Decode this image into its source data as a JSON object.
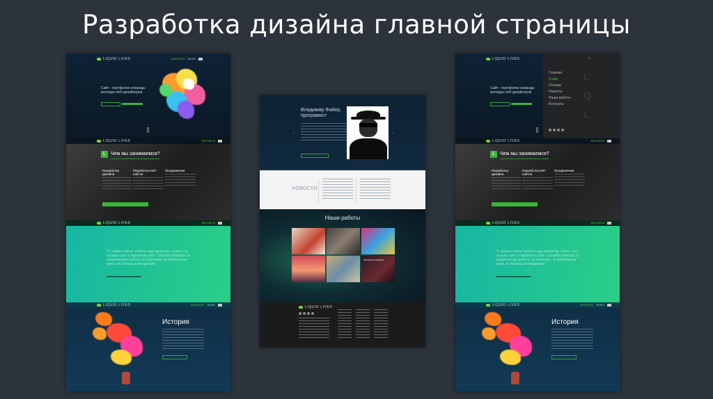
{
  "slide": {
    "title": "Разработка дизайна главной страницы"
  },
  "colors": {
    "background": "#2c333b",
    "brand_green": "#38b63b",
    "hero_dark": "#0f1f30",
    "teal_gradient_start": "#1bb4a4",
    "teal_gradient_end": "#2ad07c"
  },
  "brand": {
    "logo_text": "LIQUID LIVES"
  },
  "nav": {
    "contacts": "КОНТАКТЫ",
    "menu": "МЕНЮ"
  },
  "left_mock": {
    "hero_text": "Сайт - портфолио команды молодых веб-дизайнеров",
    "section_title": "Чем мы занимаемся?",
    "section_icon_letter": "L",
    "columns": [
      {
        "title": "Разработка дизайна"
      },
      {
        "title": "Разработка веб-сайтов"
      },
      {
        "title": "Продвижение"
      }
    ],
    "quote": "\"С первых минут работы над проектом, понял, что создаю сайт в надежные руки. Спасибо команде за проделанную работу, за терпение, за креативные идеи, за помощь в внедрении\"",
    "history_title": "История"
  },
  "center_mock": {
    "person_name": "Владимир Файер,",
    "person_role": "програмист",
    "news_label": "НОВОСТИ",
    "works_title": "Наши работы",
    "gallery_caption": "Интернет-магазин"
  },
  "right_mock": {
    "hero_text": "Сайт - портфолио команды молодых веб-дизайнеров",
    "menu_items": [
      "Главная",
      "О нас",
      "Отзывы",
      "Новости",
      "Наши работы",
      "Контакты"
    ],
    "menu_letters": [
      "L",
      "Q",
      "L"
    ],
    "section_title": "Чем мы занимаемся?",
    "section_icon_letter": "L",
    "columns": [
      {
        "title": "Разработка дизайна"
      },
      {
        "title": "Разработка веб-сайтов"
      },
      {
        "title": "Продвижение"
      }
    ],
    "quote": "\"С первых минут работы над проектом, понял, что создаю сайт в надежные руки. Спасибо команде за проделанную работу, за терпение, за креативные идеи, за помощь в внедрении\"",
    "history_title": "История"
  }
}
